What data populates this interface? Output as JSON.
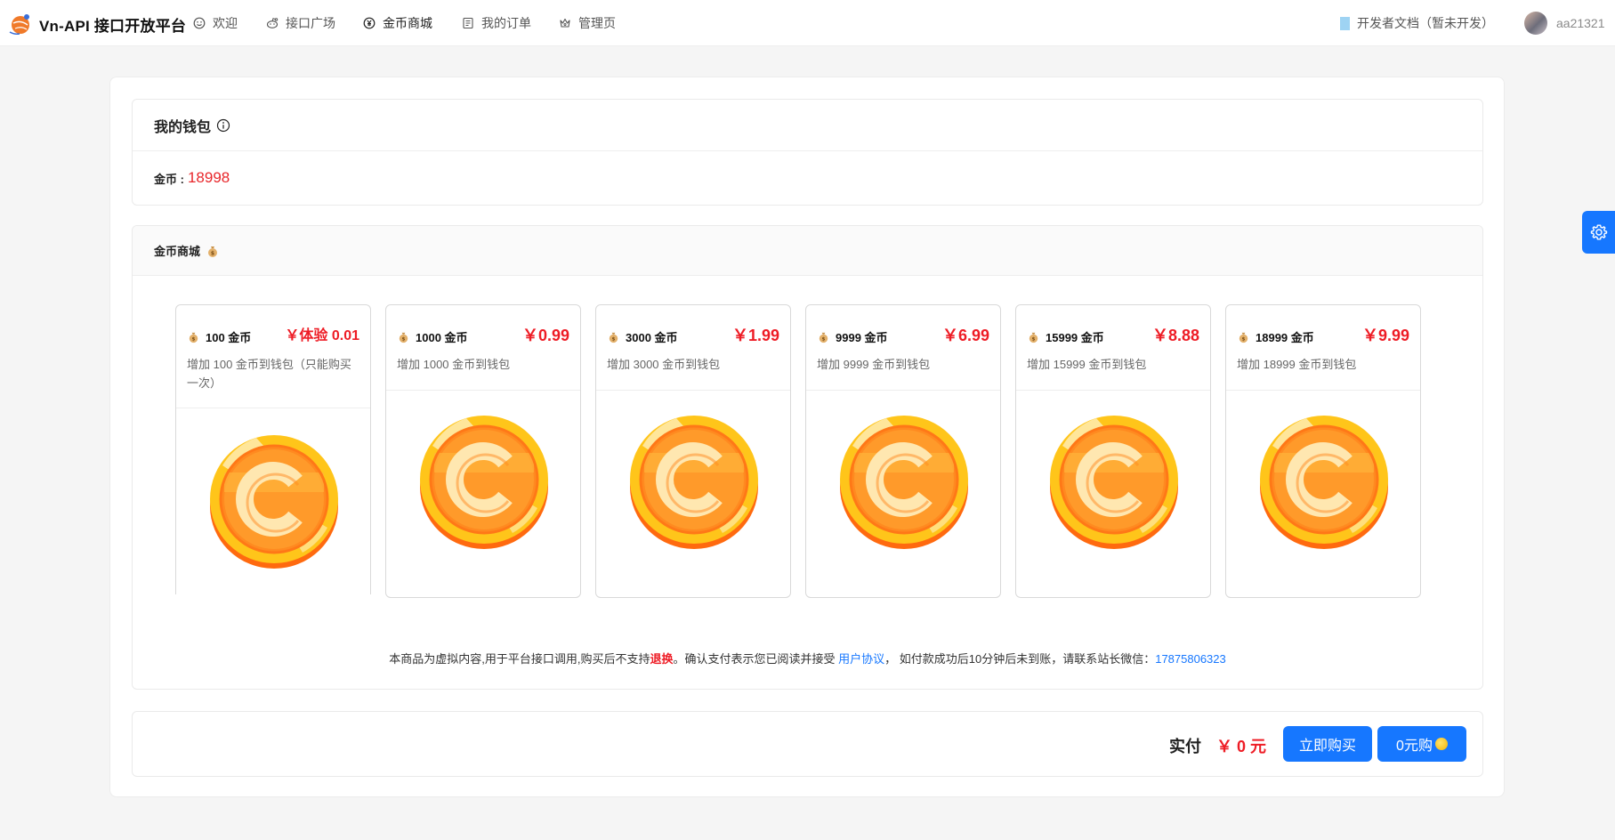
{
  "header": {
    "title": "Vn-API 接口开放平台",
    "nav": [
      {
        "label": "欢迎",
        "icon": "smile-icon"
      },
      {
        "label": "接口广场",
        "icon": "reddit-icon"
      },
      {
        "label": "金币商城",
        "icon": "yuan-circle-icon"
      },
      {
        "label": "我的订单",
        "icon": "order-list-icon"
      },
      {
        "label": "管理页",
        "icon": "crown-icon"
      }
    ],
    "doc_link": "开发者文档（暂未开发）",
    "username": "aa21321"
  },
  "wallet": {
    "title": "我的钱包",
    "coin_label": "金币 :",
    "coin_value": "18998"
  },
  "shop": {
    "title": "金币商城",
    "products": [
      {
        "name": "100 金币",
        "price": "￥体验 0.01",
        "desc": "增加 100 金币到钱包（只能购买一次）"
      },
      {
        "name": "1000 金币",
        "price": "￥0.99",
        "desc": "增加 1000 金币到钱包"
      },
      {
        "name": "3000 金币",
        "price": "￥1.99",
        "desc": "增加 3000 金币到钱包"
      },
      {
        "name": "9999 金币",
        "price": "￥6.99",
        "desc": "增加 9999 金币到钱包"
      },
      {
        "name": "15999 金币",
        "price": "￥8.88",
        "desc": "增加 15999 金币到钱包"
      },
      {
        "name": "18999 金币",
        "price": "￥9.99",
        "desc": "增加 18999 金币到钱包"
      }
    ],
    "notice": {
      "part1": "本商品为虚拟内容,用于平台接口调用,购买后不支持",
      "highlight": "退换",
      "part2": "。确认支付表示您已阅读并接受 ",
      "agreement": "用户协议",
      "part3": "， 如付款成功后10分钟后未到账，请联系站长微信：",
      "wechat": "17875806323"
    }
  },
  "payment": {
    "label": "实付",
    "amount": "￥ 0 元",
    "buy_button": "立即购买",
    "zero_button": "0元购"
  },
  "colors": {
    "primary": "#1677ff",
    "price_red": "#ee1c25"
  }
}
